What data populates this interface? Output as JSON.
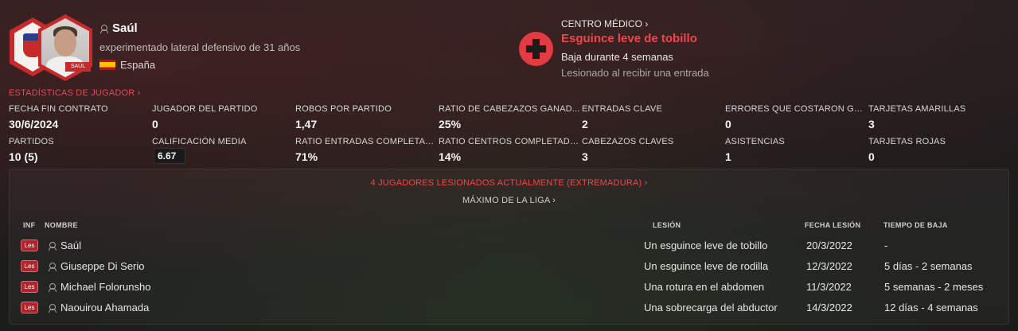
{
  "player": {
    "name": "Saúl",
    "description": "experimentado lateral defensivo de 31 años",
    "nationality": "España",
    "photo_tag": "SAÚL"
  },
  "medical": {
    "heading": "CENTRO MÉDICO ›",
    "injury_title": "Esguince leve de tobillo",
    "duration": "Baja durante 4 semanas",
    "cause": "Lesionado al recibir una entrada"
  },
  "stats": {
    "link": "ESTADÍSTICAS DE JUGADOR ›",
    "items": [
      {
        "label": "FECHA FIN CONTRATO",
        "value": "30/6/2024"
      },
      {
        "label": "JUGADOR DEL PARTIDO",
        "value": "0"
      },
      {
        "label": "ROBOS POR PARTIDO",
        "value": "1,47"
      },
      {
        "label": "RATIO DE CABEZAZOS GANAD...",
        "value": "25%"
      },
      {
        "label": "ENTRADAS CLAVE",
        "value": "2"
      },
      {
        "label": "ERRORES QUE COSTARON GOLES",
        "value": "0"
      },
      {
        "label": "TARJETAS AMARILLAS",
        "value": "3"
      },
      {
        "label": "PARTIDOS",
        "value": "10 (5)"
      },
      {
        "label": "CALIFICACIÓN MEDIA",
        "value": "6.67"
      },
      {
        "label": "RATIO ENTRADAS COMPLETAD...",
        "value": "71%"
      },
      {
        "label": "RATIO CENTROS COMPLETADOS",
        "value": "14%"
      },
      {
        "label": "CABEZAZOS CLAVES",
        "value": "3"
      },
      {
        "label": "ASISTENCIAS",
        "value": "1"
      },
      {
        "label": "TARJETAS ROJAS",
        "value": "0"
      }
    ]
  },
  "injured": {
    "title": "4 JUGADORES LESIONADOS ACTUALMENTE (EXTREMADURA) ›",
    "subtitle": "MÁXIMO DE LA LIGA ›",
    "headers": {
      "inf": "INF",
      "name": "NOMBRE",
      "injury": "LESIÓN",
      "date": "FECHA LESIÓN",
      "time": "TIEMPO DE BAJA"
    },
    "rows": [
      {
        "badge": "Les",
        "name": "Saúl",
        "injury": "Un esguince leve de tobillo",
        "date": "20/3/2022",
        "time": "-"
      },
      {
        "badge": "Les",
        "name": "Giuseppe Di Serio",
        "injury": "Un esguince leve de rodilla",
        "date": "12/3/2022",
        "time": "5 días - 2 semanas"
      },
      {
        "badge": "Les",
        "name": "Michael Folorunsho",
        "injury": "Una rotura en el abdomen",
        "date": "11/3/2022",
        "time": "5 semanas - 2 meses"
      },
      {
        "badge": "Les",
        "name": "Naouirou Ahamada",
        "injury": "Una sobrecarga del abductor",
        "date": "14/3/2022",
        "time": "12 días - 4 semanas"
      }
    ]
  }
}
